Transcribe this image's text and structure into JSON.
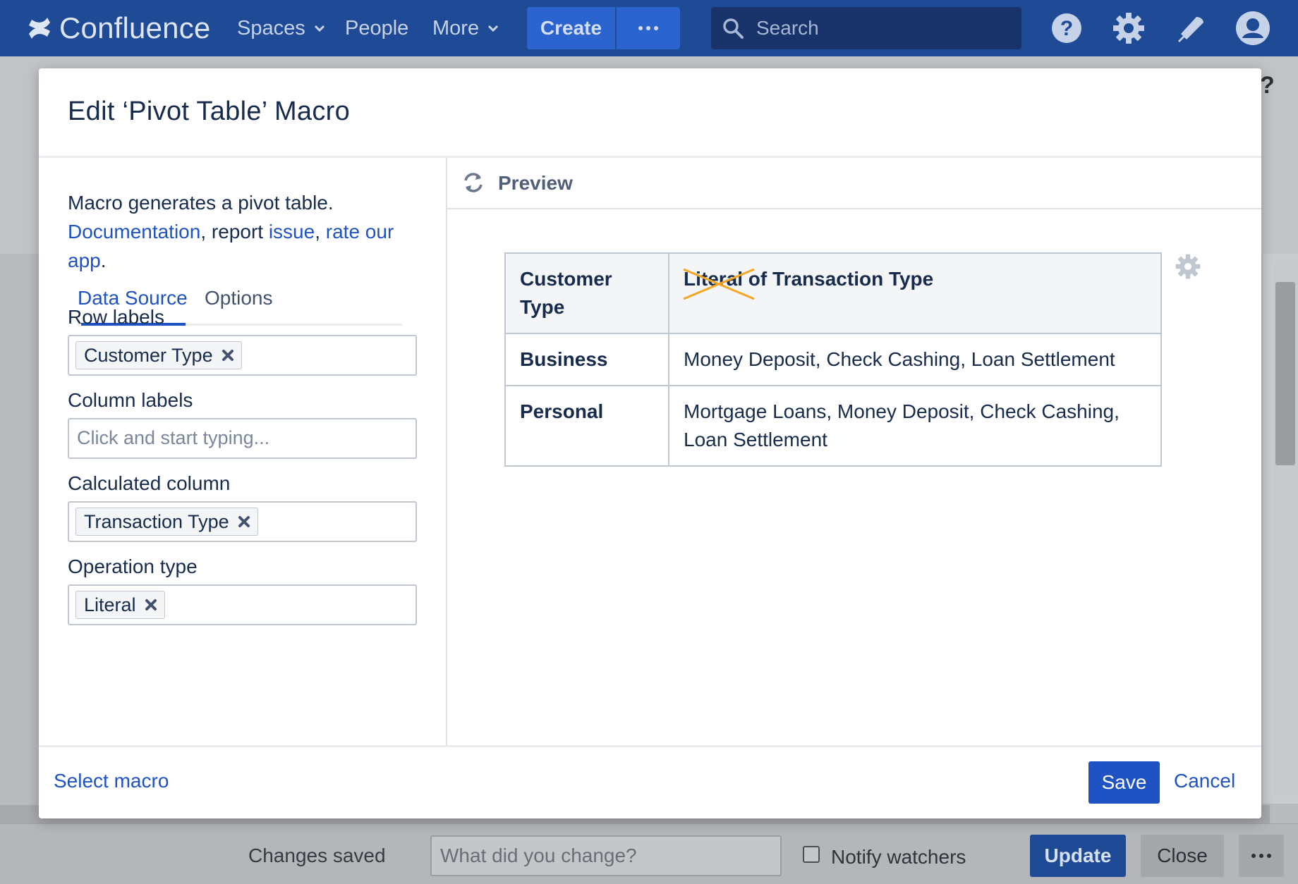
{
  "topbar": {
    "logo_text": "Confluence",
    "nav": [
      {
        "label": "Spaces",
        "has_dropdown": true
      },
      {
        "label": "People",
        "has_dropdown": false
      },
      {
        "label": "More",
        "has_dropdown": true
      }
    ],
    "create_label": "Create",
    "search_placeholder": "Search",
    "icons": [
      "help-icon",
      "settings-icon",
      "notifications-icon",
      "user-avatar-icon"
    ],
    "colors": {
      "bar": "#1f4a95",
      "create": "#2c64cf",
      "search": "#17336a"
    }
  },
  "background_page": {
    "help_glyph": "?"
  },
  "modal": {
    "title": "Edit ‘Pivot Table’ Macro",
    "description": {
      "text_1": "Macro generates a pivot table.",
      "link_documentation": "Documentation",
      "text_2": ", report ",
      "link_issue": "issue",
      "text_3": ", ",
      "link_rate": "rate our app",
      "text_4": "."
    },
    "tabs": [
      {
        "label": "Data Source",
        "active": true
      },
      {
        "label": "Options",
        "active": false
      }
    ],
    "fields": {
      "row_labels": {
        "label": "Row labels",
        "chips": [
          "Customer Type"
        ]
      },
      "column_labels": {
        "label": "Column labels",
        "placeholder": "Click and start typing..."
      },
      "calculated_column": {
        "label": "Calculated column",
        "chips": [
          "Transaction Type"
        ]
      },
      "operation_type": {
        "label": "Operation type",
        "chips": [
          "Literal"
        ]
      }
    },
    "preview": {
      "label": "Preview",
      "table": {
        "headers": {
          "col1": "Customer Type",
          "col2_struck": "Literal",
          "col2_rest": " of Transaction Type"
        },
        "rows": [
          {
            "label": "Business",
            "value": "Money Deposit, Check Cashing, Loan Settlement"
          },
          {
            "label": "Personal",
            "value": "Mortgage Loans, Money Deposit, Check Cashing, Loan Settlement"
          }
        ]
      },
      "strike_color": "#f5a623"
    },
    "footer": {
      "select_macro": "Select macro",
      "save": "Save",
      "cancel": "Cancel"
    },
    "colors": {
      "link": "#1f52c2",
      "primary": "#1f52c2"
    }
  },
  "bottombar": {
    "status": "Changes saved",
    "change_placeholder": "What did you change?",
    "notify_label": "Notify watchers",
    "notify_checked": false,
    "update": "Update",
    "close": "Close"
  }
}
